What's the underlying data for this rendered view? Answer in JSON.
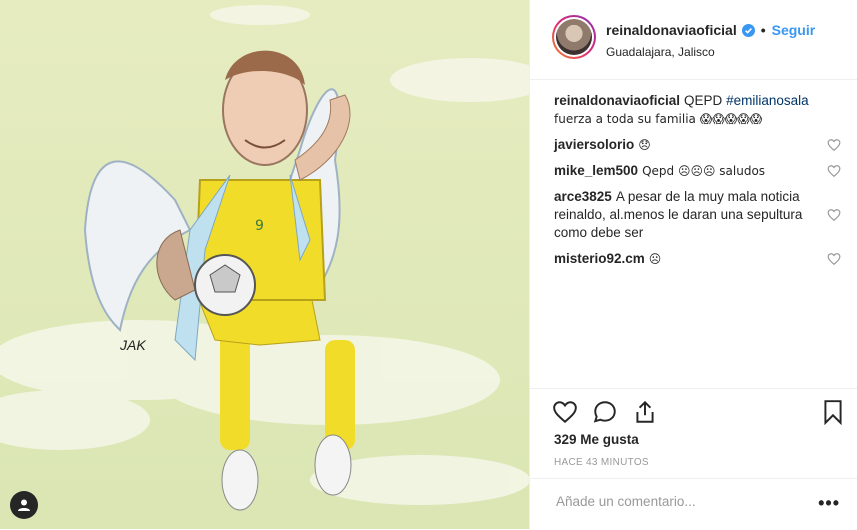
{
  "post": {
    "username": "reinaldonaviaoficial",
    "follow_label": "Seguir",
    "separator": "•",
    "location": "Guadalajara, Jalisco",
    "signature": "JAK"
  },
  "caption": {
    "username": "reinaldonaviaoficial",
    "text_before": "QEPD",
    "hashtag": "#emilianosala",
    "text_after": "fuerza a toda su familia 😱😱😱😱😱"
  },
  "comments": [
    {
      "user": "javiersolorio",
      "text": "😞"
    },
    {
      "user": "mike_lem500",
      "text": "Qepd ☹☹☹ saludos"
    },
    {
      "user": "arce3825",
      "text": "A pesar de la muy mala noticia reinaldo, al.menos le daran una sepultura como debe ser"
    },
    {
      "user": "misterio92.cm",
      "text": "☹"
    }
  ],
  "likes_text": "329 Me gusta",
  "time_text": "HACE 43 MINUTOS",
  "add_comment_placeholder": "Añade un comentario...",
  "more_label": "•••",
  "colors": {
    "link": "#3897f0",
    "hashtag": "#003569",
    "jersey": "#f2dc2a",
    "sky": "#e4ebbd"
  }
}
